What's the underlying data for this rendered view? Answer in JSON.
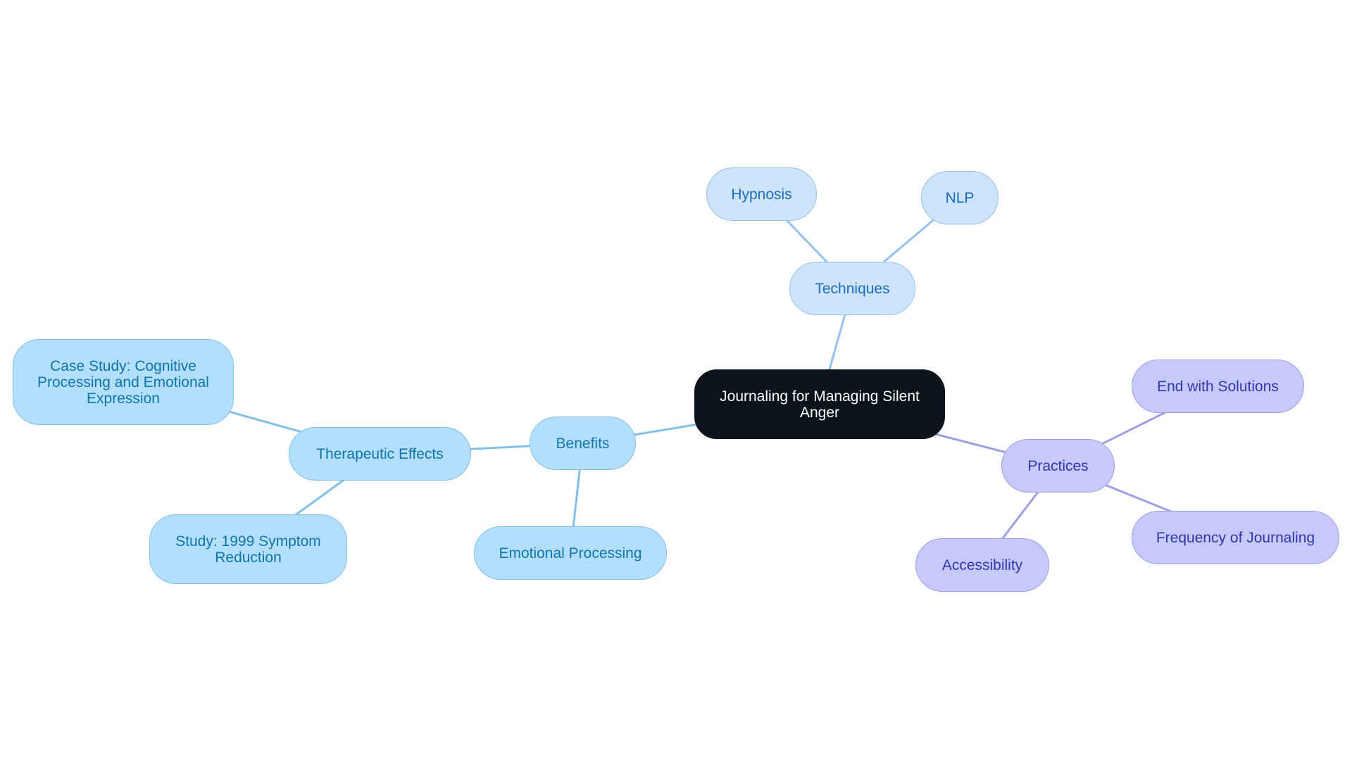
{
  "title": "Journaling for Managing Silent Anger",
  "palette": {
    "root": {
      "fill": "#0b141b",
      "stroke": "#0b141b",
      "text": "#ffffff"
    },
    "blue": {
      "fill": "#cde4fb",
      "stroke": "#96c1ee",
      "text": "#1c6bbd",
      "edge": "#96c1ee"
    },
    "sky": {
      "fill": "#b3defc",
      "stroke": "#81bfe8",
      "text": "#0f75ad",
      "edge": "#81bfe8"
    },
    "violet": {
      "fill": "#c7c9fb",
      "stroke": "#9d9fe5",
      "text": "#3035b0",
      "edge": "#9d9fe5"
    }
  },
  "nodes": [
    {
      "id": "root",
      "label": "Journaling for Managing Silent Anger",
      "theme": "root"
    },
    {
      "id": "techniques",
      "label": "Techniques",
      "theme": "blue",
      "parent": "root"
    },
    {
      "id": "hypnosis",
      "label": "Hypnosis",
      "theme": "blue",
      "parent": "techniques"
    },
    {
      "id": "nlp",
      "label": "NLP",
      "theme": "blue",
      "parent": "techniques"
    },
    {
      "id": "benefits",
      "label": "Benefits",
      "theme": "sky",
      "parent": "root"
    },
    {
      "id": "therapeutic",
      "label": "Therapeutic Effects",
      "theme": "sky",
      "parent": "benefits"
    },
    {
      "id": "casestudy",
      "label": "Case Study: Cognitive Processing and Emotional Expression",
      "theme": "sky",
      "parent": "therapeutic"
    },
    {
      "id": "study1999",
      "label": "Study: 1999 Symptom Reduction",
      "theme": "sky",
      "parent": "therapeutic"
    },
    {
      "id": "emotional",
      "label": "Emotional Processing",
      "theme": "sky",
      "parent": "benefits"
    },
    {
      "id": "practices",
      "label": "Practices",
      "theme": "violet",
      "parent": "root"
    },
    {
      "id": "endsolutions",
      "label": "End with Solutions",
      "theme": "violet",
      "parent": "practices"
    },
    {
      "id": "frequency",
      "label": "Frequency of Journaling",
      "theme": "violet",
      "parent": "practices"
    },
    {
      "id": "accessibility",
      "label": "Accessibility",
      "theme": "violet",
      "parent": "practices"
    }
  ]
}
